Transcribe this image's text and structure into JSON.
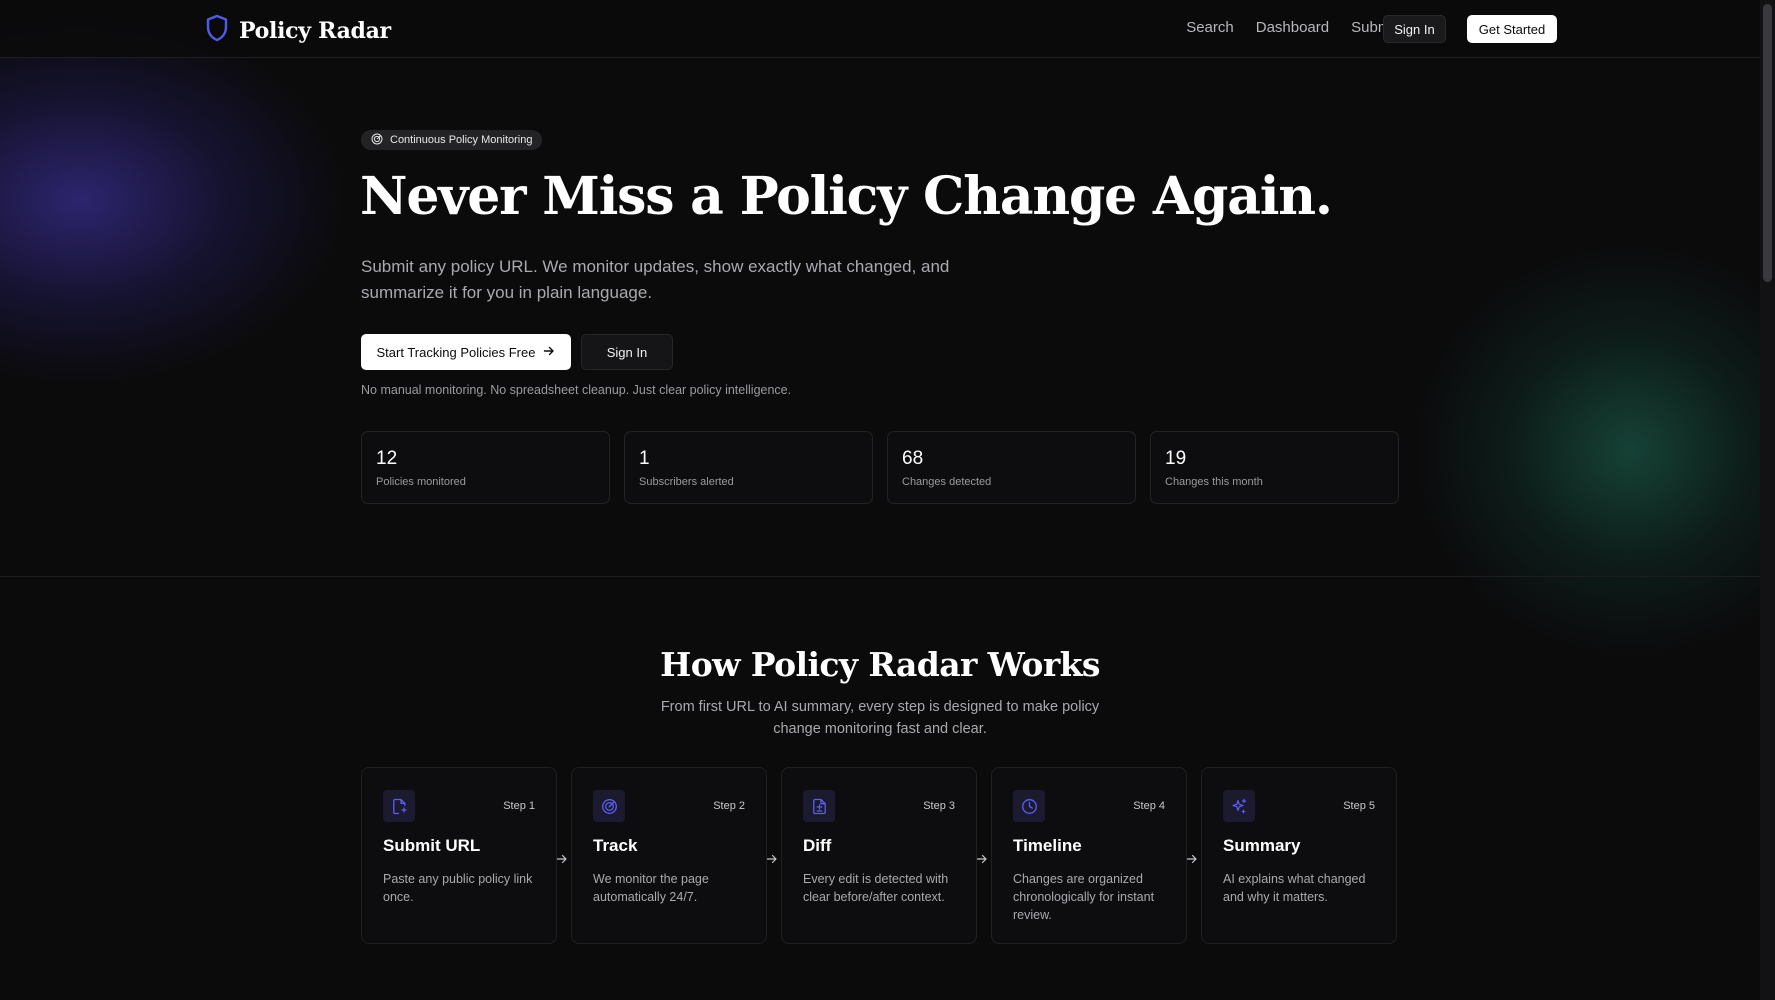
{
  "header": {
    "brand": "Policy Radar",
    "nav": [
      "Search",
      "Dashboard",
      "Submit Policy"
    ],
    "sign_in": "Sign In",
    "get_started": "Get Started"
  },
  "hero": {
    "badge": "Continuous Policy Monitoring",
    "title": "Never Miss a Policy Change Again.",
    "subtitle": "Submit any policy URL. We monitor updates, show exactly what changed, and summarize it for you in plain language.",
    "cta_primary": "Start Tracking Policies Free",
    "cta_secondary": "Sign In",
    "note": "No manual monitoring. No spreadsheet cleanup. Just clear policy intelligence."
  },
  "stats": [
    {
      "value": "12",
      "label": "Policies monitored"
    },
    {
      "value": "1",
      "label": "Subscribers alerted"
    },
    {
      "value": "68",
      "label": "Changes detected"
    },
    {
      "value": "19",
      "label": "Changes this month"
    }
  ],
  "how": {
    "title": "How Policy Radar Works",
    "subtitle": "From first URL to AI summary, every step is designed to make policy change monitoring fast and clear.",
    "steps": [
      {
        "num": "Step 1",
        "title": "Submit URL",
        "desc": "Paste any public policy link once.",
        "icon": "file-link-icon"
      },
      {
        "num": "Step 2",
        "title": "Track",
        "desc": "We monitor the page automatically 24/7.",
        "icon": "radar-icon"
      },
      {
        "num": "Step 3",
        "title": "Diff",
        "desc": "Every edit is detected with clear before/after context.",
        "icon": "file-diff-icon"
      },
      {
        "num": "Step 4",
        "title": "Timeline",
        "desc": "Changes are organized chronologically for instant review.",
        "icon": "clock-icon"
      },
      {
        "num": "Step 5",
        "title": "Summary",
        "desc": "AI explains what changed and why it matters.",
        "icon": "sparkles-icon"
      }
    ]
  },
  "colors": {
    "accent": "#4f46e5",
    "background": "#0b0b0c"
  }
}
